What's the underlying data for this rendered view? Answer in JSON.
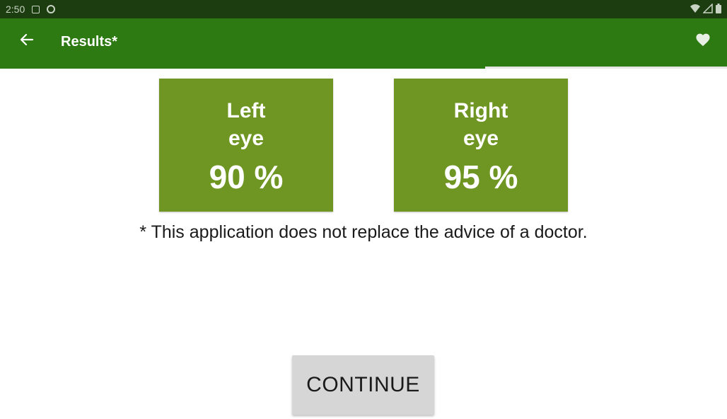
{
  "status_bar": {
    "time": "2:50"
  },
  "app_bar": {
    "title": "Results*",
    "back_icon": "arrow-left-icon",
    "favorite_icon": "heart-icon"
  },
  "progress": {
    "fraction": 0.667
  },
  "results": {
    "left": {
      "label_line1": "Left",
      "label_line2": "eye",
      "value": "90 %"
    },
    "right": {
      "label_line1": "Right",
      "label_line2": "eye",
      "value": "95 %"
    }
  },
  "disclaimer": "* This application does not replace the advice of a doctor.",
  "continue_label": "CONTINUE",
  "colors": {
    "app_bar": "#2d7a12",
    "status_bar": "#1b3d0f",
    "card": "#6f9522",
    "button": "#d6d6d6"
  }
}
